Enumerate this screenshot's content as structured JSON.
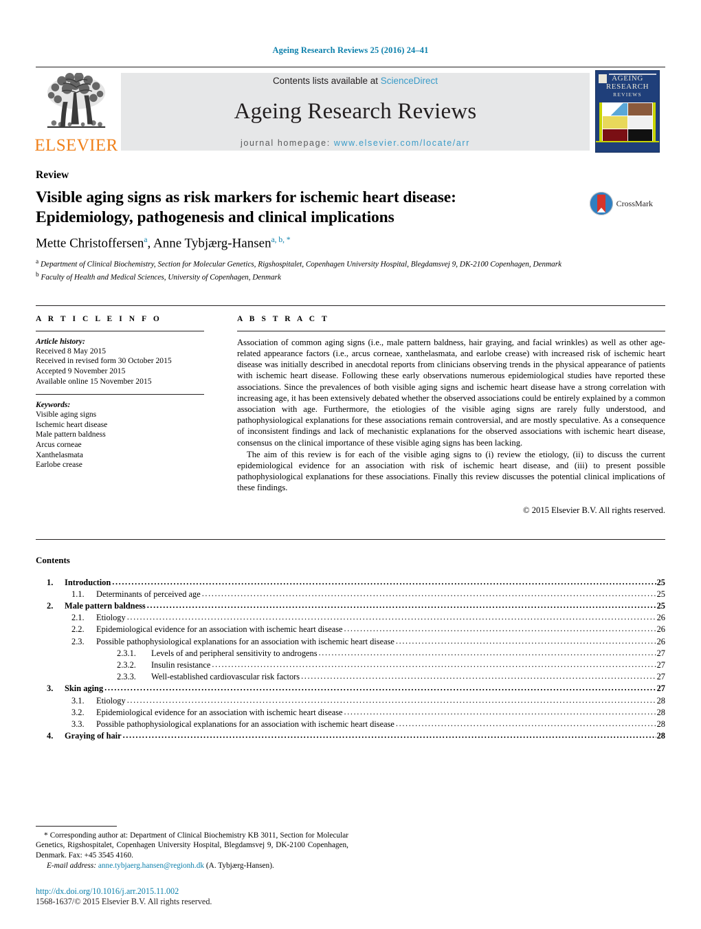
{
  "running_head": "Ageing Research Reviews 25 (2016) 24–41",
  "masthead": {
    "publisher_name": "ELSEVIER",
    "contents_line_prefix": "Contents lists available at ",
    "contents_link": "ScienceDirect",
    "journal_title": "Ageing Research Reviews",
    "homepage_prefix": "journal homepage: ",
    "homepage_url": "www.elsevier.com/locate/arr",
    "cover": {
      "line1": "AGEING",
      "line2": "RESEARCH",
      "line3": "REVIEWS"
    }
  },
  "article": {
    "category": "Review",
    "title": "Visible aging signs as risk markers for ischemic heart disease: Epidemiology, pathogenesis and clinical implications",
    "crossmark_label": "CrossMark",
    "authors": [
      {
        "name": "Mette Christoffersen",
        "marks": "a"
      },
      {
        "name": "Anne Tybjærg-Hansen",
        "marks": "a, b, *"
      }
    ],
    "affiliations": [
      {
        "mark": "a",
        "text": "Department of Clinical Biochemistry, Section for Molecular Genetics, Rigshospitalet, Copenhagen University Hospital, Blegdamsvej 9, DK-2100 Copenhagen, Denmark"
      },
      {
        "mark": "b",
        "text": "Faculty of Health and Medical Sciences, University of Copenhagen, Denmark"
      }
    ]
  },
  "article_info": {
    "heading": "A R T I C L E   I N F O",
    "history_title": "Article history:",
    "history": [
      "Received 8 May 2015",
      "Received in revised form 30 October 2015",
      "Accepted 9 November 2015",
      "Available online 15 November 2015"
    ],
    "keywords_title": "Keywords:",
    "keywords": [
      "Visible aging signs",
      "Ischemic heart disease",
      "Male pattern baldness",
      "Arcus corneae",
      "Xanthelasmata",
      "Earlobe crease"
    ]
  },
  "abstract": {
    "heading": "A B S T R A C T",
    "paragraphs": [
      "Association of common aging signs (i.e., male pattern baldness, hair graying, and facial wrinkles) as well as other age-related appearance factors (i.e., arcus corneae, xanthelasmata, and earlobe crease) with increased risk of ischemic heart disease was initially described in anecdotal reports from clinicians observing trends in the physical appearance of patients with ischemic heart disease. Following these early observations numerous epidemiological studies have reported these associations. Since the prevalences of both visible aging signs and ischemic heart disease have a strong correlation with increasing age, it has been extensively debated whether the observed associations could be entirely explained by a common association with age. Furthermore, the etiologies of the visible aging signs are rarely fully understood, and pathophysiological explanations for these associations remain controversial, and are mostly speculative. As a consequence of inconsistent findings and lack of mechanistic explanations for the observed associations with ischemic heart disease, consensus on the clinical importance of these visible aging signs has been lacking.",
      "The aim of this review is for each of the visible aging signs to (i) review the etiology, (ii) to discuss the current epidemiological evidence for an association with risk of ischemic heart disease, and (iii) to present possible pathophysiological explanations for these associations. Finally this review discusses the potential clinical implications of these findings."
    ],
    "copyright": "© 2015 Elsevier B.V. All rights reserved."
  },
  "contents": {
    "heading": "Contents",
    "entries": [
      {
        "level": 1,
        "num": "1.",
        "label": "Introduction",
        "page": "25"
      },
      {
        "level": 2,
        "num": "1.1.",
        "label": "Determinants of perceived age",
        "page": "25"
      },
      {
        "level": 1,
        "num": "2.",
        "label": "Male pattern baldness",
        "page": "25"
      },
      {
        "level": 2,
        "num": "2.1.",
        "label": "Etiology",
        "page": "26"
      },
      {
        "level": 2,
        "num": "2.2.",
        "label": "Epidemiological evidence for an association with ischemic heart disease",
        "page": "26"
      },
      {
        "level": 2,
        "num": "2.3.",
        "label": "Possible pathophysiological explanations for an association with ischemic heart disease",
        "page": "26"
      },
      {
        "level": 3,
        "num": "2.3.1.",
        "label": "Levels of and peripheral sensitivity to androgens",
        "page": "27"
      },
      {
        "level": 3,
        "num": "2.3.2.",
        "label": "Insulin resistance",
        "page": "27"
      },
      {
        "level": 3,
        "num": "2.3.3.",
        "label": "Well-established cardiovascular risk factors",
        "page": "27"
      },
      {
        "level": 1,
        "num": "3.",
        "label": "Skin aging",
        "page": "27"
      },
      {
        "level": 2,
        "num": "3.1.",
        "label": "Etiology",
        "page": "28"
      },
      {
        "level": 2,
        "num": "3.2.",
        "label": "Epidemiological evidence for an association with ischemic heart disease",
        "page": "28"
      },
      {
        "level": 2,
        "num": "3.3.",
        "label": "Possible pathophysiological explanations for an association with ischemic heart disease",
        "page": "28"
      },
      {
        "level": 1,
        "num": "4.",
        "label": "Graying of hair",
        "page": "28"
      }
    ]
  },
  "footer": {
    "corresponding_note": "* Corresponding author at: Department of Clinical Biochemistry KB 3011, Section for Molecular Genetics, Rigshospitalet, Copenhagen University Hospital, Blegdamsvej 9, DK-2100 Copenhagen, Denmark. Fax: +45 3545 4160.",
    "email_label": "E-mail address:",
    "email": "anne.tybjaerg.hansen@regionh.dk",
    "email_suffix": "(A. Tybjærg-Hansen).",
    "doi": "http://dx.doi.org/10.1016/j.arr.2015.11.002",
    "issn_line": "1568-1637/© 2015 Elsevier B.V. All rights reserved."
  },
  "colors": {
    "link": "#0b7fab",
    "sciencedirect": "#3a9bc8",
    "elsevier_orange": "#f0801a",
    "banner_bg": "#e6e7e8",
    "cover_blue": "#1f3f7a",
    "cover_lime": "#c8d400"
  }
}
